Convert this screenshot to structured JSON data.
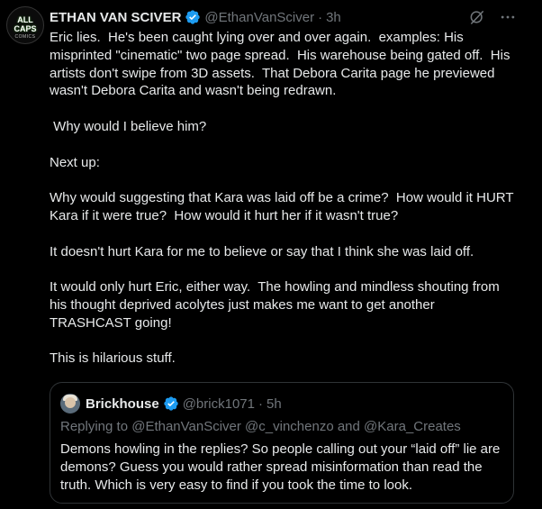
{
  "tweet": {
    "avatar_text": "ALL CAPS",
    "avatar_sub": "COMICS",
    "author_name": "ETHAN VAN SCIVER",
    "handle": "@EthanVanSciver",
    "separator": "·",
    "time": "3h",
    "icons": [
      "grok-icon",
      "more-icon"
    ],
    "paragraphs": [
      "Eric lies.  He's been caught lying over and over again.  examples: His misprinted \"cinematic\" two page spread.  His warehouse being gated off.  His artists don't swipe from 3D assets.  That Debora Carita page he previewed wasn't Debora Carita and wasn't being redrawn.",
      " Why would I believe him?",
      "Next up:",
      "Why would suggesting that Kara was laid off be a crime?  How would it HURT Kara if it were true?  How would it hurt her if it wasn't true?",
      "It doesn't hurt Kara for me to believe or say that I think she was laid off.",
      "It would only hurt Eric, either way.  The howling and mindless shouting from his thought deprived acolytes just makes me want to get another TRASHCAST going!",
      "This is hilarious stuff."
    ]
  },
  "quote": {
    "author_name": "Brickhouse",
    "handle": "@brick1071",
    "separator": "·",
    "time": "5h",
    "replying_to": "Replying to @EthanVanSciver @c_vinchenzo and @Kara_Creates",
    "text": "Demons howling in the replies? So people calling out your “laid off” lie are demons? Guess you would rather spread misinformation than read the truth. Which is very easy to find if you took the time to look."
  },
  "colors": {
    "background": "#000000",
    "text": "#e7e9ea",
    "muted": "#71767b",
    "verified": "#1d9bf0",
    "border": "#2f3336"
  }
}
